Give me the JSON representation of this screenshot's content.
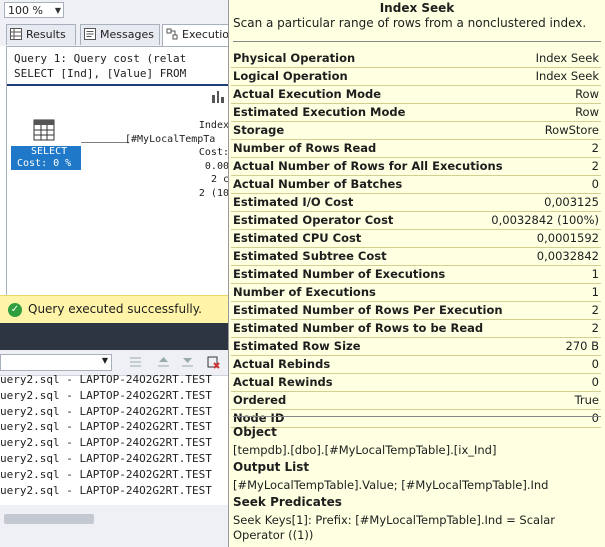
{
  "toolbar": {
    "zoom_value": "100 %"
  },
  "tabs": [
    {
      "label": "Results",
      "icon": "grid-icon"
    },
    {
      "label": "Messages",
      "icon": "messages-icon"
    },
    {
      "label": "Executio",
      "icon": "execution-plan-icon"
    }
  ],
  "plan": {
    "query_line1": "Query 1: Query cost (relat",
    "query_line2": "SELECT [Ind], [Value] FROM",
    "select_node": {
      "line1": "SELECT",
      "line2": "Cost: 0 %"
    },
    "seek_node_lines": [
      "Index",
      "[#MyLocalTempTa",
      "Cost:",
      "0.00",
      "2 c",
      "2 (10"
    ]
  },
  "status": {
    "text": "Query executed successfully.",
    "color": "#fff4a8"
  },
  "output_lines": [
    "uery2.sql - LAPTOP-24O2G2RT.TEST",
    "uery2.sql - LAPTOP-24O2G2RT.TEST",
    "uery2.sql - LAPTOP-24O2G2RT.TEST",
    "uery2.sql - LAPTOP-24O2G2RT.TEST",
    "uery2.sql - LAPTOP-24O2G2RT.TEST",
    "uery2.sql - LAPTOP-24O2G2RT.TEST",
    "uery2.sql - LAPTOP-24O2G2RT.TEST",
    "uery2.sql - LAPTOP-24O2G2RT.TEST"
  ],
  "tooltip": {
    "title": "Index Seek",
    "description": "Scan a particular range of rows from a nonclustered index.",
    "rows": [
      {
        "label": "Physical Operation",
        "value": "Index Seek"
      },
      {
        "label": "Logical Operation",
        "value": "Index Seek"
      },
      {
        "label": "Actual Execution Mode",
        "value": "Row"
      },
      {
        "label": "Estimated Execution Mode",
        "value": "Row"
      },
      {
        "label": "Storage",
        "value": "RowStore"
      },
      {
        "label": "Number of Rows Read",
        "value": "2"
      },
      {
        "label": "Actual Number of Rows for All Executions",
        "value": "2"
      },
      {
        "label": "Actual Number of Batches",
        "value": "0"
      },
      {
        "label": "Estimated I/O Cost",
        "value": "0,003125"
      },
      {
        "label": "Estimated Operator Cost",
        "value": "0,0032842 (100%)"
      },
      {
        "label": "Estimated CPU Cost",
        "value": "0,0001592"
      },
      {
        "label": "Estimated Subtree Cost",
        "value": "0,0032842"
      },
      {
        "label": "Estimated Number of Executions",
        "value": "1"
      },
      {
        "label": "Number of Executions",
        "value": "1"
      },
      {
        "label": "Estimated Number of Rows Per Execution",
        "value": "2"
      },
      {
        "label": "Estimated Number of Rows to be Read",
        "value": "2"
      },
      {
        "label": "Estimated Row Size",
        "value": "270 B"
      },
      {
        "label": "Actual Rebinds",
        "value": "0"
      },
      {
        "label": "Actual Rewinds",
        "value": "0"
      },
      {
        "label": "Ordered",
        "value": "True"
      },
      {
        "label": "Node ID",
        "value": "0"
      }
    ],
    "object_heading": "Object",
    "object_value": "[tempdb].[dbo].[#MyLocalTempTable].[ix_Ind]",
    "output_heading": "Output List",
    "output_value": "[#MyLocalTempTable].Value; [#MyLocalTempTable].Ind",
    "seek_heading": "Seek Predicates",
    "seek_value": "Seek Keys[1]: Prefix: [#MyLocalTempTable].Ind = Scalar Operator ((1))"
  }
}
